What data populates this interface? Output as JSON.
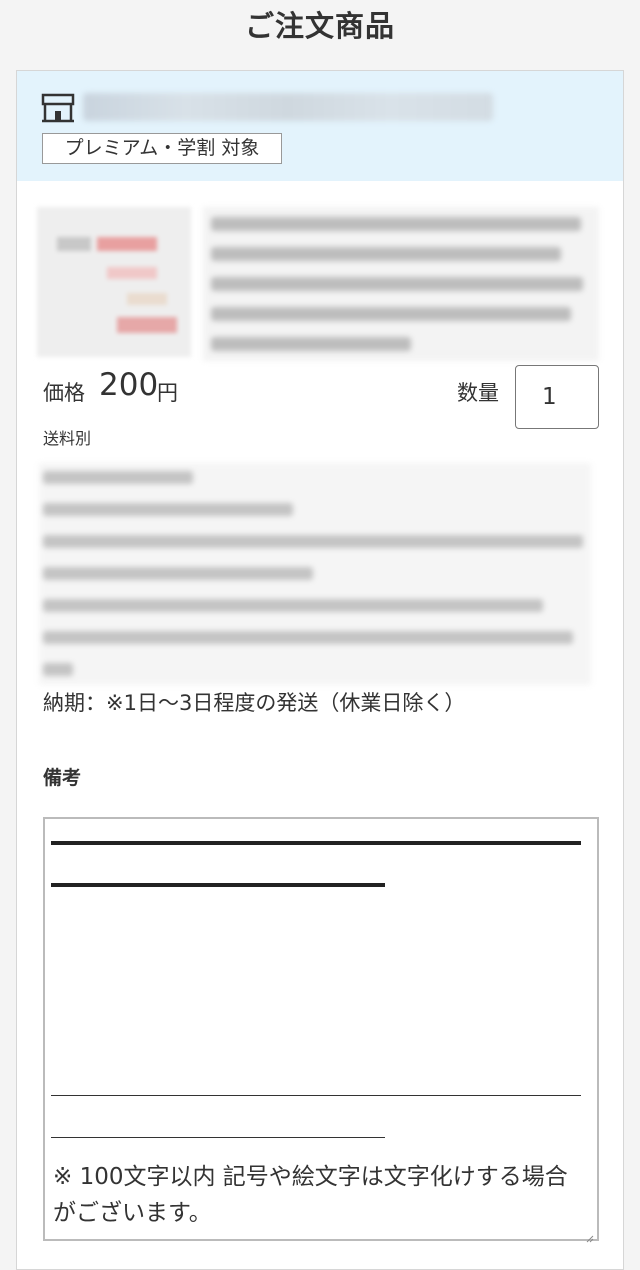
{
  "header": {
    "title": "ご注文商品"
  },
  "shop": {
    "icon": "store-icon",
    "badge": "プレミアム・学割 対象"
  },
  "product": {
    "price_label": "価格",
    "price_value": "200",
    "price_unit": "円",
    "quantity_label": "数量",
    "quantity_value": "1",
    "shipping": "送料別",
    "delivery": "納期：※1日～3日程度の発送（休業日除く）"
  },
  "remarks": {
    "label": "備考",
    "hint": "※ 100文字以内 記号や絵文字は文字化けする場合がございます。"
  }
}
